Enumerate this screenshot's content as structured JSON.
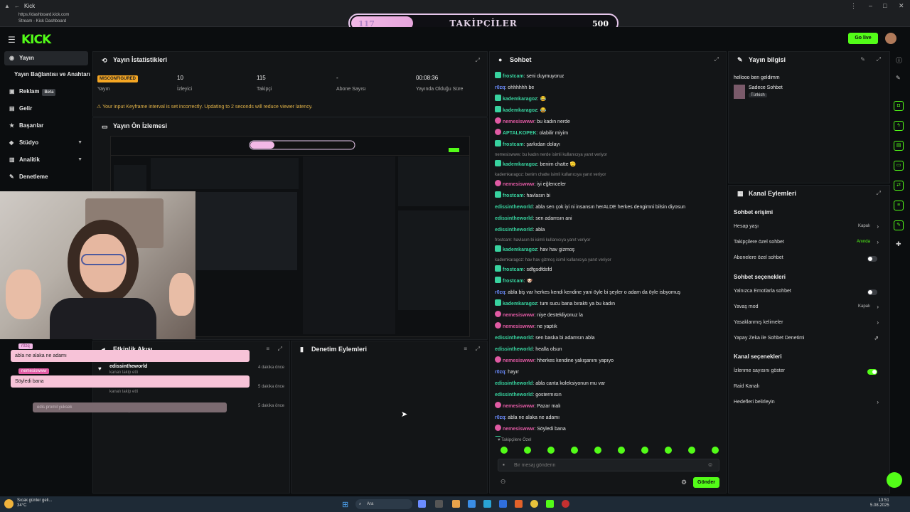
{
  "browser": {
    "tab_title": "Kick",
    "url": "https://dashboard.kick.com",
    "subtitle": "Stream - Kick Dashboard"
  },
  "goal": {
    "current": "117",
    "label": "TAKİPÇİLER",
    "target": "500",
    "progress": 0.234
  },
  "header": {
    "logo": "KICK",
    "go_live": "Go live"
  },
  "sidebar": {
    "items": [
      {
        "label": "Yayın",
        "icon": "broadcast-icon"
      },
      {
        "label": "Reklam",
        "icon": "ad-icon",
        "badge": "Beta"
      },
      {
        "label": "Gelir",
        "icon": "revenue-icon"
      },
      {
        "label": "Başarılar",
        "icon": "trophy-icon"
      },
      {
        "label": "Stüdyo",
        "icon": "studio-icon"
      },
      {
        "label": "Analitik",
        "icon": "chart-icon"
      },
      {
        "label": "Denetleme",
        "icon": "moderation-icon"
      }
    ],
    "sub_item": "Yayın Bağlantısı ve Anahtarı"
  },
  "stats": {
    "title": "Yayın İstatistikleri",
    "status_badge": "MISCONFIGURED",
    "status_label": "Yayın",
    "viewers": "10",
    "viewers_label": "İzleyici",
    "followers": "115",
    "followers_label": "Takipçi",
    "subs": "-",
    "subs_label": "Abone Sayısı",
    "uptime": "00:08:36",
    "uptime_label": "Yayında Olduğu Süre",
    "warning": "Your input Keyframe interval is set incorrectly. Updating to 2 seconds will reduce viewer latency."
  },
  "preview": {
    "title": "Yayın Ön İzlemesi"
  },
  "overlay_chat": [
    {
      "name": "r0zq",
      "text": "abla ne alaka ne adamı"
    },
    {
      "name": "nemesiswww",
      "text": "Söyledi bana"
    },
    {
      "name": "",
      "text": "edis promil yuksek"
    }
  ],
  "activity": {
    "title": "Etkinlik Akışı",
    "items": [
      {
        "name": "edissintheworld",
        "sub": "kanalı takip etti",
        "time": "4 dakika önce"
      },
      {
        "name": "",
        "sub": "kanalı takip etti",
        "time": "5 dakika önce"
      },
      {
        "name": "r0zq",
        "sub": "kanalı takip etti",
        "time": "5 dakika önce"
      }
    ]
  },
  "moderation": {
    "title": "Denetim Eylemleri"
  },
  "chat": {
    "title": "Sohbet",
    "messages": [
      {
        "user": "frostcam",
        "text": "seni duymuyoruz",
        "color": "#38d39f",
        "badge": "green"
      },
      {
        "user": "r0zq",
        "text": "ohhhhhh be",
        "color": "#6b8cff",
        "badge": "none"
      },
      {
        "user": "kademkaragoz",
        "text": "😂",
        "color": "#38d39f",
        "badge": "green"
      },
      {
        "user": "kademkaragoz",
        "text": "😂",
        "color": "#38d39f",
        "badge": "green"
      },
      {
        "user": "nemesiswww",
        "text": "bu kadın nerde",
        "color": "#e05aa3",
        "badge": "pink"
      },
      {
        "user": "APTALKOPEK",
        "text": "olabilir miyim",
        "color": "#38d39f",
        "badge": "pink"
      },
      {
        "user": "frostcam",
        "text": "şarkıdan dolayı",
        "color": "#38d39f",
        "badge": "green"
      },
      {
        "user": "",
        "text": "nemesiswww: bu kadın nerde isimli kullanıcıya yanıt veriyor",
        "color": "#888",
        "badge": "sys"
      },
      {
        "user": "kademkaragoz",
        "text": "benim chatte 🫡",
        "color": "#38d39f",
        "badge": "green"
      },
      {
        "user": "",
        "text": "kademkaragoz: benim chatte isimli kullanıcıya yanıt veriyor",
        "color": "#888",
        "badge": "sys"
      },
      {
        "user": "nemesiswww",
        "text": "iyi eğlenceler",
        "color": "#e05aa3",
        "badge": "pink"
      },
      {
        "user": "frostcam",
        "text": "havlasın bi",
        "color": "#38d39f",
        "badge": "green"
      },
      {
        "user": "edissintheworld",
        "text": "abla sen çok iyi ni insansın herALDE herkes dengimni bilsin diyosun",
        "color": "#38d39f",
        "badge": "none"
      },
      {
        "user": "edissintheworld",
        "text": "sen adamsın ani",
        "color": "#38d39f",
        "badge": "none"
      },
      {
        "user": "edissintheworld",
        "text": "abla",
        "color": "#38d39f",
        "badge": "none"
      },
      {
        "user": "",
        "text": "frostcam: havlasın bi isimli kullanıcıya yanıt veriyor",
        "color": "#888",
        "badge": "sys"
      },
      {
        "user": "kademkaragoz",
        "text": "hav hav gizmoş",
        "color": "#38d39f",
        "badge": "green"
      },
      {
        "user": "",
        "text": "kademkaragoz: hav hav gizmoş isimli kullanıcıya yanıt veriyor",
        "color": "#888",
        "badge": "sys"
      },
      {
        "user": "frostcam",
        "text": "sdfgsdfdsfd",
        "color": "#38d39f",
        "badge": "green"
      },
      {
        "user": "frostcam",
        "text": "🐶",
        "color": "#38d39f",
        "badge": "green"
      },
      {
        "user": "r0zq",
        "text": "abla biş var herkes kendi kendine yani öyle bi şeyler o adam da öyle isbyomuş",
        "color": "#6b8cff",
        "badge": "none"
      },
      {
        "user": "kademkaragoz",
        "text": "tum sucu bana bıraktı ya bu kadın",
        "color": "#38d39f",
        "badge": "green"
      },
      {
        "user": "nemesiswww",
        "text": "niye destekliyonuz la",
        "color": "#e05aa3",
        "badge": "pink"
      },
      {
        "user": "nemesiswww",
        "text": "ne yaptık",
        "color": "#e05aa3",
        "badge": "pink"
      },
      {
        "user": "edissintheworld",
        "text": "sen baska bi adamsın abla",
        "color": "#38d39f",
        "badge": "none"
      },
      {
        "user": "edissintheworld",
        "text": "healla olsun",
        "color": "#38d39f",
        "badge": "none"
      },
      {
        "user": "nemesiswww",
        "text": "hherkes kendine yakışanını yapıyo",
        "color": "#e05aa3",
        "badge": "pink"
      },
      {
        "user": "r0zq",
        "text": "hayır",
        "color": "#6b8cff",
        "badge": "none"
      },
      {
        "user": "edissintheworld",
        "text": "abla canta koleksiyonun mu var",
        "color": "#38d39f",
        "badge": "none"
      },
      {
        "user": "edissintheworld",
        "text": "gostermısın",
        "color": "#38d39f",
        "badge": "none"
      },
      {
        "user": "nemesiswww",
        "text": "Pazar malı",
        "color": "#e05aa3",
        "badge": "pink"
      },
      {
        "user": "r0zq",
        "text": "abla ne alaka ne adamı",
        "color": "#6b8cff",
        "badge": "none"
      },
      {
        "user": "nemesiswww",
        "text": "Söyledi bana",
        "color": "#e05aa3",
        "badge": "pink"
      },
      {
        "user": "kademkaragoz",
        "text": "edis promil yuksek",
        "color": "#38d39f",
        "badge": "green"
      }
    ],
    "followers_only": "Takipçilere Özel",
    "input_placeholder": "Bir mesaj gönderin",
    "send_label": "Gönder"
  },
  "stream_info": {
    "title": "Yayın bilgisi",
    "stream_title": "hellooo ben geldimm",
    "category": "Sadece Sohbet",
    "tag": "Türkish"
  },
  "channel_actions": {
    "title": "Kanal Eylemleri",
    "chat_access_head": "Sohbet erişimi",
    "account_age": "Hesap yaşı",
    "account_age_val": "Kapalı",
    "followers_only": "Takipçilere özel sohbet",
    "followers_only_val": "Anında",
    "subs_only": "Abonelere özel sohbet",
    "chat_options_head": "Sohbet seçenekleri",
    "emote_only": "Yalnızca Emotlarla sohbet",
    "slow_mode": "Yavaş mod",
    "slow_mode_val": "Kapalı",
    "banned_words": "Yasaklanmış kelimeler",
    "ai_moderation": "Yapay Zeka ile Sohbet Denetimi",
    "channel_options_head": "Kanal seçenekleri",
    "show_viewers": "İzlenme sayısını göster",
    "raid": "Raid Kanalı",
    "goals": "Hedefleri belirleyin"
  },
  "taskbar": {
    "weather_line1": "Sıcak günler geli...",
    "weather_line2": "34°C",
    "search": "Ara",
    "time": "13:51",
    "date": "5.08.2025"
  },
  "colors": {
    "accent": "#53fc18",
    "warning": "#f5a623"
  }
}
